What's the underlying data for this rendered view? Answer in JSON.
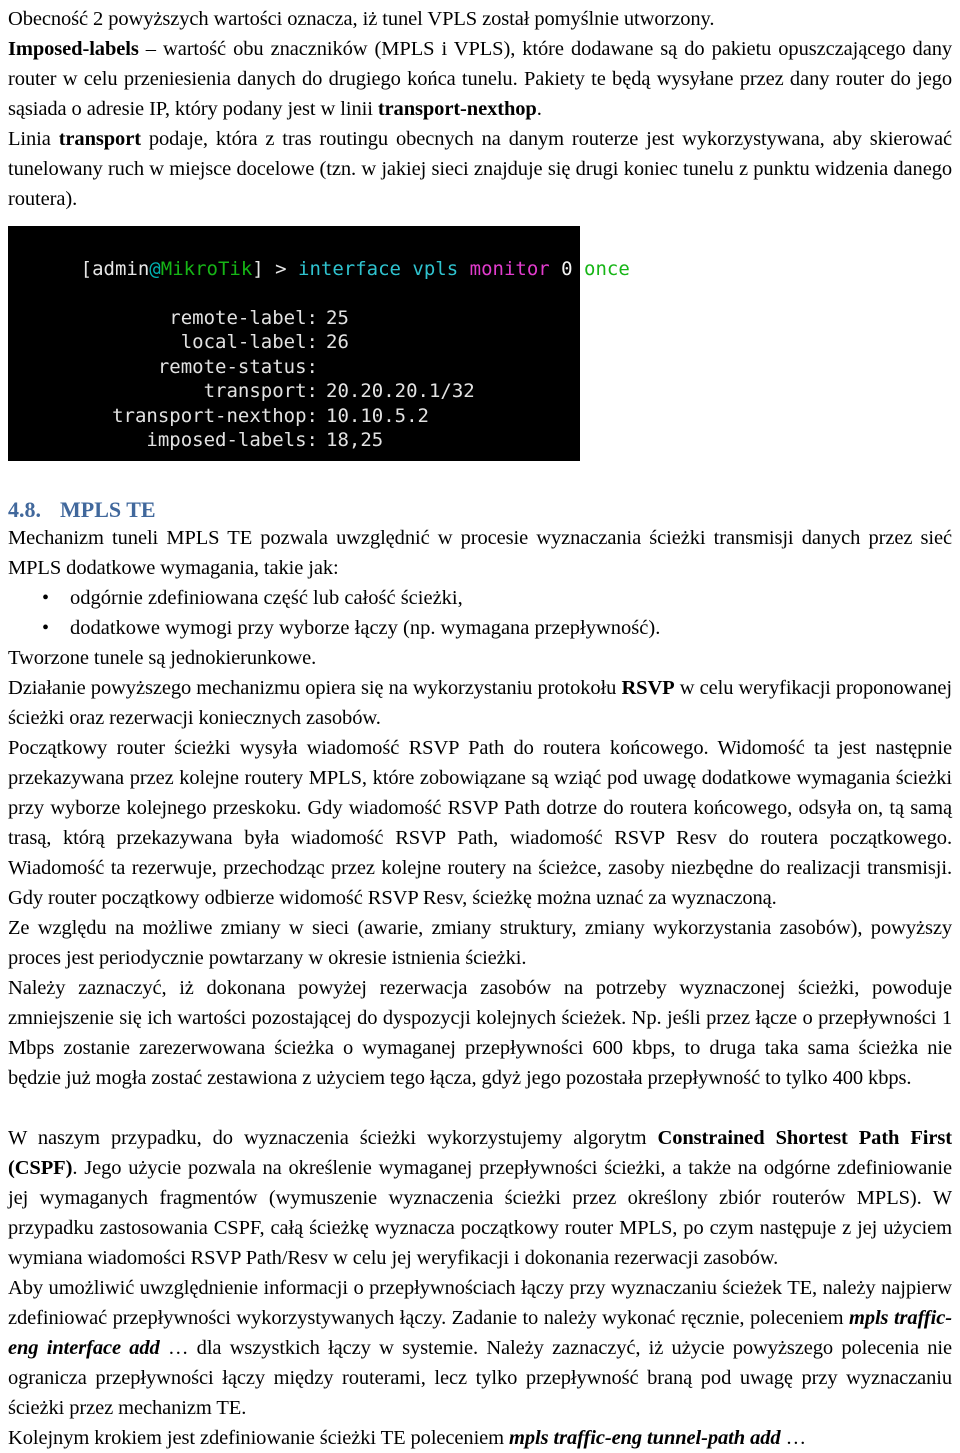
{
  "document": {
    "language": "pl",
    "heading_color": "#41689c",
    "paragraphs_top": [
      {
        "id": "p-obecnosc",
        "runs": [
          {
            "text": "Obecność 2 powyższych wartości oznacza, iż tunel VPLS został pomyślnie utworzony.",
            "style": "normal"
          }
        ]
      },
      {
        "id": "p-imposed-labels",
        "runs": [
          {
            "text": "Imposed-labels",
            "style": "bold"
          },
          {
            "text": " – wartość obu znaczników (MPLS i VPLS), które dodawane są do pakietu opuszczającego dany router w celu przeniesienia danych do drugiego końca tunelu. Pakiety te będą wysyłane przez dany router do jego sąsiada o adresie IP, który podany jest w linii ",
            "style": "normal"
          },
          {
            "text": "transport-nexthop",
            "style": "bold"
          },
          {
            "text": ".",
            "style": "normal"
          }
        ]
      },
      {
        "id": "p-linia-transport",
        "runs": [
          {
            "text": "Linia ",
            "style": "normal"
          },
          {
            "text": "transport",
            "style": "bold"
          },
          {
            "text": " podaje, która z tras routingu obecnych na danym routerze jest wykorzystywana, aby skierować tunelowany ruch w miejsce docelowe (tzn. w jakiej sieci znajduje się drugi koniec tunelu z punktu widzenia danego routera).",
            "style": "normal"
          }
        ]
      }
    ],
    "terminal": {
      "name": "mikrotik-cli-screenshot",
      "background": "#000000",
      "prompt": {
        "bracket_open": "[",
        "user": "admin",
        "at": "@",
        "host": "MikroTik",
        "bracket_close": "] > ",
        "command": "interface vpls ",
        "subcommand": "monitor ",
        "argument": "0",
        "option": " once"
      },
      "rows": [
        {
          "key": "remote-label:",
          "value": "25"
        },
        {
          "key": "local-label:",
          "value": "26"
        },
        {
          "key": "remote-status:",
          "value": ""
        },
        {
          "key": "transport:",
          "value": "20.20.20.1/32"
        },
        {
          "key": "transport-nexthop:",
          "value": "10.10.5.2"
        },
        {
          "key": "imposed-labels:",
          "value": "18,25"
        }
      ]
    },
    "section": {
      "number": "4.8.",
      "title": "MPLS TE"
    },
    "paragraphs_mid": [
      {
        "id": "p-mechanizm",
        "runs": [
          {
            "text": "Mechanizm tuneli MPLS TE pozwala uwzględnić w procesie wyznaczania ścieżki transmisji danych przez sieć MPLS dodatkowe wymagania, takie jak:",
            "style": "normal"
          }
        ]
      }
    ],
    "bullets": [
      {
        "dot": "•",
        "text": "odgórnie zdefiniowana część lub całość ścieżki,"
      },
      {
        "dot": "•",
        "text": "dodatkowe wymogi przy wyborze łączy (np. wymagana przepływność)."
      }
    ],
    "paragraphs_after_bullets": [
      {
        "id": "p-tworzone",
        "runs": [
          {
            "text": "Tworzone tunele są jednokierunkowe.",
            "style": "normal"
          }
        ]
      },
      {
        "id": "p-dzialanie",
        "runs": [
          {
            "text": "Działanie powyższego mechanizmu opiera się na wykorzystaniu protokołu ",
            "style": "normal"
          },
          {
            "text": "RSVP",
            "style": "bold"
          },
          {
            "text": " w celu weryfikacji proponowanej ścieżki oraz rezerwacji koniecznych zasobów.",
            "style": "normal"
          }
        ]
      },
      {
        "id": "p-poczatkowy",
        "runs": [
          {
            "text": "Początkowy router ścieżki wysyła wiadomość RSVP Path do routera końcowego. Widomość ta jest następnie przekazywana przez kolejne routery MPLS, które zobowiązane są wziąć pod uwagę dodatkowe wymagania ścieżki przy wyborze kolejnego przeskoku. Gdy wiadomość RSVP Path dotrze do routera końcowego, odsyła on, tą samą trasą, którą przekazywana była wiadomość RSVP Path, wiadomość RSVP Resv do routera początkowego. Wiadomość ta rezerwuje, przechodząc przez kolejne routery na ścieżce, zasoby niezbędne do realizacji transmisji. Gdy router początkowy odbierze widomość RSVP Resv, ścieżkę można uznać za wyznaczoną.",
            "style": "normal"
          }
        ]
      },
      {
        "id": "p-zewzgledu",
        "runs": [
          {
            "text": "Ze względu na możliwe zmiany w sieci (awarie, zmiany struktury, zmiany wykorzystania zasobów), powyższy proces jest periodycznie powtarzany w okresie istnienia ścieżki.",
            "style": "normal"
          }
        ]
      },
      {
        "id": "p-nalezy-zaznaczyc",
        "runs": [
          {
            "text": "Należy zaznaczyć, iż dokonana powyżej rezerwacja zasobów na potrzeby wyznaczonej ścieżki, powoduje zmniejszenie się ich wartości pozostającej do dyspozycji kolejnych ścieżek. Np. jeśli przez łącze o przepływności 1 Mbps zostanie zarezerwowana ścieżka o wymaganej przepływności 600 kbps, to druga taka sama ścieżka nie będzie już mogła zostać zestawiona z użyciem tego łącza, gdyż jego pozostała przepływność to tylko 400 kbps.",
            "style": "normal"
          }
        ]
      }
    ],
    "paragraphs_bottom": [
      {
        "id": "p-cspf",
        "runs": [
          {
            "text": "W naszym przypadku, do wyznaczenia ścieżki wykorzystujemy algorytm ",
            "style": "normal"
          },
          {
            "text": "Constrained Shortest Path First (CSPF)",
            "style": "bold"
          },
          {
            "text": ". Jego użycie pozwala na określenie wymaganej przepływności ścieżki, a także na odgórne zdefiniowanie jej wymaganych fragmentów (wymuszenie wyznaczenia ścieżki przez określony zbiór routerów MPLS). W przypadku zastosowania CSPF, całą ścieżkę wyznacza początkowy router MPLS, po czym następuje z jej użyciem wymiana wiadomości RSVP Path/Resv w celu jej weryfikacji i dokonania rezerwacji zasobów.",
            "style": "normal"
          }
        ]
      },
      {
        "id": "p-aby-umozliwic",
        "runs": [
          {
            "text": "Aby umożliwić uwzględnienie informacji o przepływnościach łączy przy wyznaczaniu ścieżek TE, należy najpierw zdefiniować przepływności wykorzystywanych łączy. Zadanie to należy wykonać ręcznie, poleceniem ",
            "style": "normal"
          },
          {
            "text": "mpls traffic-eng interface add",
            "style": "bolditalic"
          },
          {
            "text": " … dla wszystkich łączy w systemie. Należy zaznaczyć, iż użycie powyższego polecenia nie ogranicza przepływności łączy między routerami, lecz tylko przepływność braną pod uwagę przy wyznaczaniu ścieżki przez mechanizm TE.",
            "style": "normal"
          }
        ]
      },
      {
        "id": "p-kolejnym-krokiem",
        "runs": [
          {
            "text": "Kolejnym krokiem jest zdefiniowanie ścieżki TE poleceniem ",
            "style": "normal"
          },
          {
            "text": "mpls traffic-eng tunnel-path add",
            "style": "bolditalic"
          },
          {
            "text": " …",
            "style": "normal"
          }
        ]
      }
    ]
  }
}
